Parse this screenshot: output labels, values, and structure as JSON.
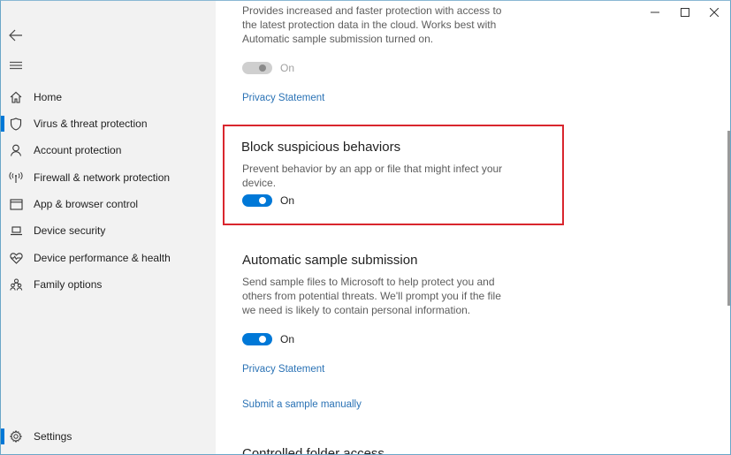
{
  "window": {
    "controls": {
      "minimize": "minimize",
      "maximize": "maximize",
      "close": "close"
    }
  },
  "sidebar": {
    "back_icon": "back-arrow-icon",
    "menu_icon": "hamburger-menu-icon",
    "items": [
      {
        "label": "Home",
        "icon": "home-icon",
        "active": false
      },
      {
        "label": "Virus & threat protection",
        "icon": "shield-icon",
        "active": true
      },
      {
        "label": "Account protection",
        "icon": "person-icon",
        "active": false
      },
      {
        "label": "Firewall & network protection",
        "icon": "wireless-signal-icon",
        "active": false
      },
      {
        "label": "App & browser control",
        "icon": "app-window-icon",
        "active": false
      },
      {
        "label": "Device security",
        "icon": "laptop-icon",
        "active": false
      },
      {
        "label": "Device performance & health",
        "icon": "heart-pulse-icon",
        "active": false
      },
      {
        "label": "Family options",
        "icon": "family-icon",
        "active": false
      }
    ],
    "settings": {
      "label": "Settings",
      "icon": "gear-icon",
      "active": true
    }
  },
  "main": {
    "cloud_protection": {
      "description": "Provides increased and faster protection with access to the latest protection data in the cloud.  Works best with Automatic sample submission turned on.",
      "description_lines": [
        "Provides increased and faster protection with access to",
        "the latest protection data in the cloud.  Works best with",
        "Automatic sample submission turned on."
      ],
      "toggle_state": "On",
      "toggle_enabled": false,
      "privacy_link": "Privacy Statement"
    },
    "block_suspicious": {
      "title": "Block suspicious behaviors",
      "description_lines": [
        "Prevent behavior by an app or file that might infect your",
        "device."
      ],
      "toggle_state": "On",
      "toggle_enabled": true,
      "highlight_color": "#d9262e"
    },
    "automatic_sample": {
      "title": "Automatic sample submission",
      "description_lines": [
        "Send sample files to Microsoft to help protect you and",
        "others from potential threats.  We'll prompt you if the file",
        "we need is likely to contain personal information."
      ],
      "toggle_state": "On",
      "toggle_enabled": true,
      "privacy_link": "Privacy Statement",
      "submit_link": "Submit a sample manually"
    },
    "controlled_folder": {
      "title": "Controlled folder access"
    }
  },
  "colors": {
    "accent": "#0078d7",
    "link": "#2a72b5",
    "highlight": "#d9262e",
    "sidebar_bg": "#f2f2f2"
  }
}
